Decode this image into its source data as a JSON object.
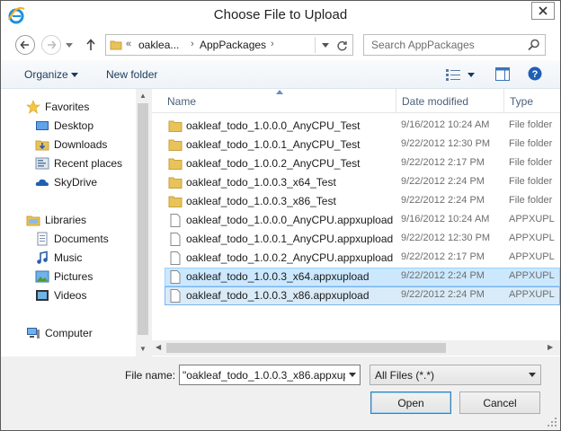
{
  "window": {
    "title": "Choose File to Upload",
    "app_icon": "ie-icon",
    "close_icon": "close-icon"
  },
  "nav": {
    "back_icon": "back-arrow-icon",
    "forward_icon": "forward-arrow-icon",
    "up_icon": "up-arrow-icon",
    "address": {
      "overflow": "«",
      "crumbs": [
        "oaklea...",
        "AppPackages"
      ],
      "separator": "›"
    },
    "refresh_icon": "refresh-icon",
    "search_placeholder": "Search AppPackages"
  },
  "toolbar": {
    "organize_label": "Organize",
    "new_folder_label": "New folder"
  },
  "sidebar": {
    "favorites": {
      "label": "Favorites",
      "items": [
        "Desktop",
        "Downloads",
        "Recent places",
        "SkyDrive"
      ]
    },
    "libraries": {
      "label": "Libraries",
      "items": [
        "Documents",
        "Music",
        "Pictures",
        "Videos"
      ]
    },
    "computer_label": "Computer"
  },
  "columns": {
    "name": "Name",
    "date": "Date modified",
    "type": "Type"
  },
  "files": [
    {
      "name": "oakleaf_todo_1.0.0.0_AnyCPU_Test",
      "date": "9/16/2012 10:24 AM",
      "type": "File folder",
      "kind": "folder"
    },
    {
      "name": "oakleaf_todo_1.0.0.1_AnyCPU_Test",
      "date": "9/22/2012 12:30 PM",
      "type": "File folder",
      "kind": "folder"
    },
    {
      "name": "oakleaf_todo_1.0.0.2_AnyCPU_Test",
      "date": "9/22/2012 2:17 PM",
      "type": "File folder",
      "kind": "folder"
    },
    {
      "name": "oakleaf_todo_1.0.0.3_x64_Test",
      "date": "9/22/2012 2:24 PM",
      "type": "File folder",
      "kind": "folder"
    },
    {
      "name": "oakleaf_todo_1.0.0.3_x86_Test",
      "date": "9/22/2012 2:24 PM",
      "type": "File folder",
      "kind": "folder"
    },
    {
      "name": "oakleaf_todo_1.0.0.0_AnyCPU.appxupload",
      "date": "9/16/2012 10:24 AM",
      "type": "APPXUPL",
      "kind": "file"
    },
    {
      "name": "oakleaf_todo_1.0.0.1_AnyCPU.appxupload",
      "date": "9/22/2012 12:30 PM",
      "type": "APPXUPL",
      "kind": "file"
    },
    {
      "name": "oakleaf_todo_1.0.0.2_AnyCPU.appxupload",
      "date": "9/22/2012 2:17 PM",
      "type": "APPXUPL",
      "kind": "file"
    },
    {
      "name": "oakleaf_todo_1.0.0.3_x64.appxupload",
      "date": "9/22/2012 2:24 PM",
      "type": "APPXUPL",
      "kind": "file",
      "state": "selected"
    },
    {
      "name": "oakleaf_todo_1.0.0.3_x86.appxupload",
      "date": "9/22/2012 2:24 PM",
      "type": "APPXUPL",
      "kind": "file",
      "state": "selected-focused"
    }
  ],
  "footer": {
    "file_name_label": "File name:",
    "file_name_value": "\"oakleaf_todo_1.0.0.3_x86.appxupl",
    "filter_value": "All Files (*.*)",
    "open_label": "Open",
    "cancel_label": "Cancel"
  },
  "colors": {
    "selection_bg": "#cce8ff",
    "selection_border": "#99d1ff",
    "header_text": "#4c607a",
    "folder": "#e8c35a"
  }
}
